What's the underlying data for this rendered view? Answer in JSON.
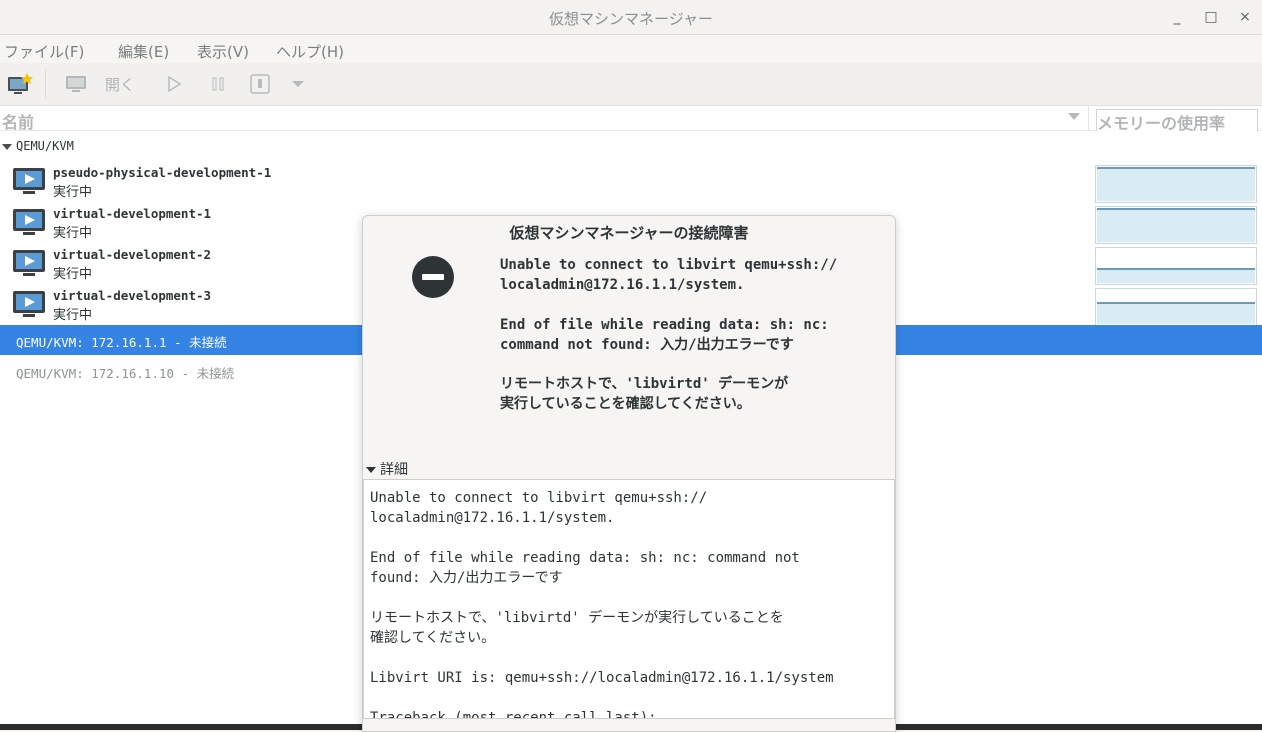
{
  "window": {
    "title": "仮想マシンマネージャー",
    "minimize": "_",
    "maximize": "□",
    "close": "×"
  },
  "menu": [
    "ファイル(F)",
    "編集(E)",
    "表示(V)",
    "ヘルプ(H)"
  ],
  "toolbar": {
    "open_label": "開く"
  },
  "columns": {
    "name": "名前",
    "memory": "メモリーの使用率"
  },
  "connections": [
    {
      "label": "QEMU/KVM",
      "vms": [
        {
          "name": "pseudo-physical-development-1",
          "status": "実行中",
          "memory_usage": 0.9
        },
        {
          "name": "virtual-development-1",
          "status": "実行中",
          "memory_usage": 0.88
        },
        {
          "name": "virtual-development-2",
          "status": "実行中",
          "memory_usage": 0.35
        },
        {
          "name": "virtual-development-3",
          "status": "実行中",
          "memory_usage": 0.55
        }
      ]
    }
  ],
  "selected_connection": "QEMU/KVM: 172.16.1.1 - 未接続",
  "other_connection": "QEMU/KVM: 172.16.1.10 - 未接続",
  "dialog": {
    "title": "仮想マシンマネージャーの接続障害",
    "msg1": "Unable to connect to libvirt qemu+ssh://\nlocaladmin@172.16.1.1/system.",
    "msg2": "End of file while reading data: sh: nc:\ncommand not found: 入力/出力エラーです",
    "msg3": "リモートホストで、'libvirtd' デーモンが\n実行していることを確認してください。",
    "details_label": "詳細",
    "details_text": "Unable to connect to libvirt qemu+ssh://\nlocaladmin@172.16.1.1/system.\n\nEnd of file while reading data: sh: nc: command not\nfound: 入力/出力エラーです\n\nリモートホストで、'libvirtd' デーモンが実行していることを\n確認してください。\n\nLibvirt URI is: qemu+ssh://localadmin@172.16.1.1/system\n\nTraceback (most recent call last):"
  }
}
